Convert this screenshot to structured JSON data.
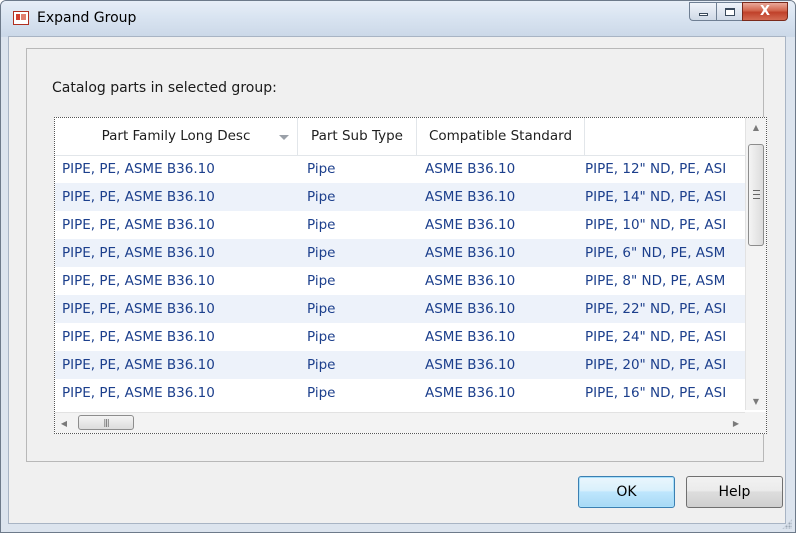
{
  "window": {
    "title": "Expand Group",
    "controls": {
      "minimize": "minimize-icon",
      "maximize": "maximize-icon",
      "close": "X"
    }
  },
  "group": {
    "label": "Catalog parts in selected group:"
  },
  "grid": {
    "columns": [
      "Part Family Long Desc",
      "Part Sub Type",
      "Compatible Standard",
      ""
    ],
    "sort_icon": "sort-descending-icon",
    "rows": [
      [
        "PIPE, PE, ASME B36.10",
        "Pipe",
        "ASME B36.10",
        "PIPE, 12\" ND, PE, ASI"
      ],
      [
        "PIPE, PE, ASME B36.10",
        "Pipe",
        "ASME B36.10",
        "PIPE, 14\" ND, PE, ASI"
      ],
      [
        "PIPE, PE, ASME B36.10",
        "Pipe",
        "ASME B36.10",
        "PIPE, 10\" ND, PE, ASI"
      ],
      [
        "PIPE, PE, ASME B36.10",
        "Pipe",
        "ASME B36.10",
        "PIPE, 6\" ND, PE, ASM"
      ],
      [
        "PIPE, PE, ASME B36.10",
        "Pipe",
        "ASME B36.10",
        "PIPE, 8\" ND, PE, ASM"
      ],
      [
        "PIPE, PE, ASME B36.10",
        "Pipe",
        "ASME B36.10",
        "PIPE, 22\" ND, PE, ASI"
      ],
      [
        "PIPE, PE, ASME B36.10",
        "Pipe",
        "ASME B36.10",
        "PIPE, 24\" ND, PE, ASI"
      ],
      [
        "PIPE, PE, ASME B36.10",
        "Pipe",
        "ASME B36.10",
        "PIPE, 20\" ND, PE, ASI"
      ],
      [
        "PIPE, PE, ASME B36.10",
        "Pipe",
        "ASME B36.10",
        "PIPE, 16\" ND, PE, ASI"
      ]
    ],
    "row_text_color": "#1c3f8c",
    "alt_row_color": "#edf2fa"
  },
  "buttons": {
    "ok": "OK",
    "help": "Help"
  },
  "colors": {
    "ok_button_border": "#3c7fb1",
    "close_button": "#c0412a"
  }
}
